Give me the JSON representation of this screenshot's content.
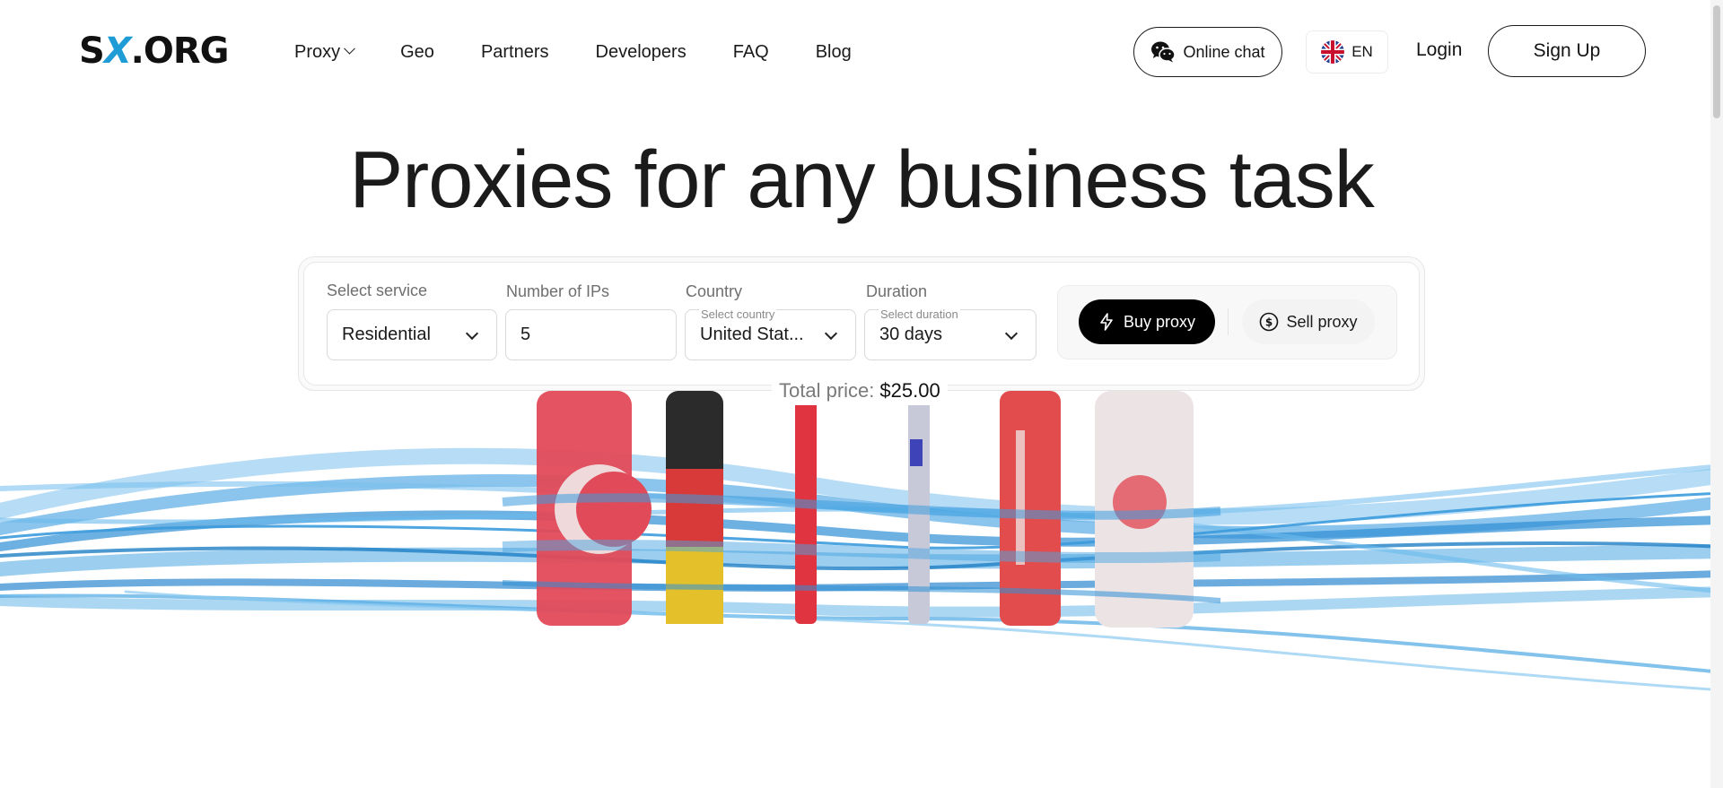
{
  "header": {
    "logo_text": "SX.ORG",
    "logo_part1": "S",
    "logo_part2": "X",
    "logo_part3": ".ORG",
    "nav": [
      {
        "label": "Proxy",
        "has_dropdown": true
      },
      {
        "label": "Geo"
      },
      {
        "label": "Partners"
      },
      {
        "label": "Developers"
      },
      {
        "label": "FAQ"
      },
      {
        "label": "Blog"
      }
    ],
    "online_chat_label": "Online chat",
    "language": "EN",
    "login_label": "Login",
    "signup_label": "Sign Up"
  },
  "hero": {
    "title": "Proxies for any business task"
  },
  "form": {
    "service": {
      "label": "Select service",
      "value": "Residential"
    },
    "ips": {
      "label": "Number of IPs",
      "value": "5"
    },
    "country": {
      "label": "Country",
      "hint": "Select country",
      "value": "United Stat..."
    },
    "duration": {
      "label": "Duration",
      "hint": "Select duration",
      "value": "30 days"
    },
    "buy_label": "Buy proxy",
    "sell_label": "Sell proxy",
    "total_label": "Total price:",
    "total_value": "$25.00"
  },
  "colors": {
    "accent": "#000000",
    "logo_x": "#1f9bd6",
    "fiber": "#3d9ddf"
  },
  "icons": [
    "chevron-down-icon",
    "wechat-icon",
    "uk-flag-icon",
    "lightning-icon",
    "dollar-circle-icon"
  ]
}
